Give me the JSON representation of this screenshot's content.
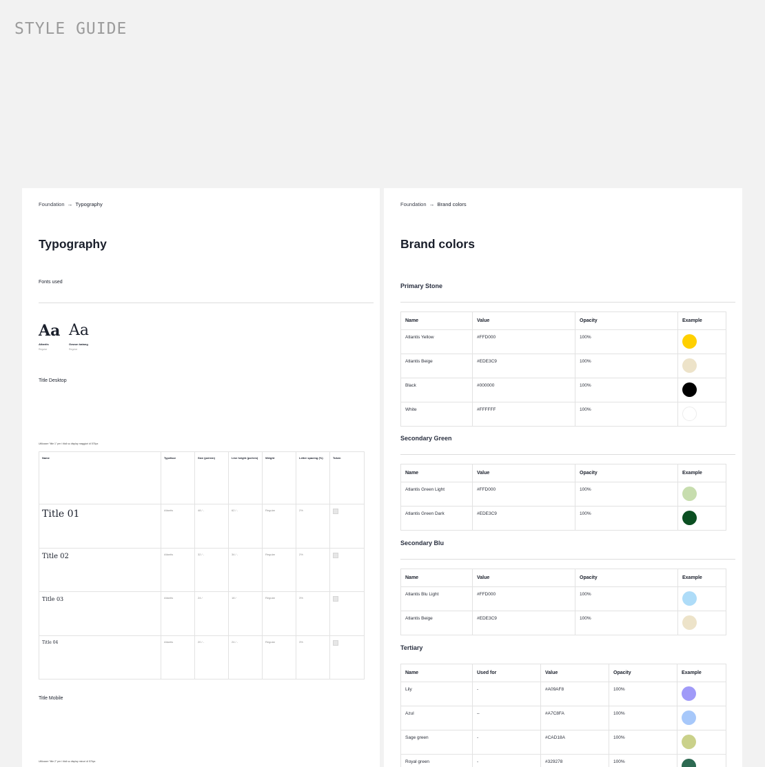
{
  "header": {
    "title": "STYLE GUIDE"
  },
  "typography": {
    "breadcrumb": {
      "parent": "Foundation",
      "current": "Typography"
    },
    "title": "Typography",
    "fonts_used_label": "Fonts used",
    "fonts": [
      {
        "glyph": "Aa",
        "name": "Atlantis",
        "style": "Regular"
      },
      {
        "glyph": "Aa",
        "name": "Gowun batang",
        "style": "Regular"
      }
    ],
    "title_desktop_label": "Title Desktop",
    "desktop_note": "Utilizzare \"title 1\" per i titoli su display maggiori di 576px",
    "table": {
      "headers": [
        "Name",
        "Typeface",
        "Size (px/rem)",
        "Line height (px/rem)",
        "Weight",
        "Letter spacing (%)",
        "Token"
      ],
      "rows": [
        {
          "name": "Title 01",
          "typeface": "Atlantis",
          "size": "48 / -",
          "line_height": "62 / -",
          "weight": "Regular",
          "letter_spacing": "2%"
        },
        {
          "name": "Title 02",
          "typeface": "Atlantis",
          "size": "32 / -",
          "line_height": "34 / -",
          "weight": "Regular",
          "letter_spacing": "2%"
        },
        {
          "name": "Title 03",
          "typeface": "Atlantis",
          "size": "24 /",
          "line_height": "18 /",
          "weight": "Regular",
          "letter_spacing": "3%"
        },
        {
          "name": "Title 04",
          "typeface": "Atlantis",
          "size": "20 / -",
          "line_height": "24 / -",
          "weight": "Regular",
          "letter_spacing": "3%"
        }
      ]
    },
    "title_mobile_label": "Title Mobile",
    "mobile_note": "Utilizzare \"title 2\" per i titoli su display minori di 576px"
  },
  "brand_colors": {
    "breadcrumb": {
      "parent": "Foundation",
      "current": "Brand colors"
    },
    "title": "Brand colors",
    "headers": [
      "Name",
      "Value",
      "Opacity",
      "Example"
    ],
    "tertiary_headers": [
      "Name",
      "Used for",
      "Value",
      "Opacity",
      "Example"
    ],
    "sections": [
      {
        "title": "Primary Stone",
        "rows": [
          {
            "name": "Atlantis Yellow",
            "value": "#FFD000",
            "opacity": "100%",
            "swatch": "#FFD000"
          },
          {
            "name": "Atlantis Beige",
            "value": "#EDE3C9",
            "opacity": "100%",
            "swatch": "#EDE3C9"
          },
          {
            "name": "Black",
            "value": "#000000",
            "opacity": "100%",
            "swatch": "#000000"
          },
          {
            "name": "White",
            "value": "#FFFFFF",
            "opacity": "100%",
            "swatch": "#FFFFFF"
          }
        ]
      },
      {
        "title": "Secondary Green",
        "rows": [
          {
            "name": "Atlantis Green Light",
            "value": "#FFD000",
            "opacity": "100%",
            "swatch": "#C7DDAE"
          },
          {
            "name": "Atlantis Green Dark",
            "value": "#EDE3C9",
            "opacity": "100%",
            "swatch": "#0B4F22"
          }
        ]
      },
      {
        "title": "Secondary Blu",
        "rows": [
          {
            "name": "Atlantis Blu Light",
            "value": "#FFD000",
            "opacity": "100%",
            "swatch": "#AEDCF8"
          },
          {
            "name": "Atlantis Beige",
            "value": "#EDE3C9",
            "opacity": "100%",
            "swatch": "#EDE3C9"
          }
        ]
      },
      {
        "title": "Tertiary",
        "rows": [
          {
            "name": "Lily",
            "used_for": "-",
            "value": "#A09AF8",
            "opacity": "100%",
            "swatch": "#A09AF8"
          },
          {
            "name": "Azul",
            "used_for": "–",
            "value": "#A7C8FA",
            "opacity": "100%",
            "swatch": "#A7C8FA"
          },
          {
            "name": "Sage green",
            "used_for": "-",
            "value": "#CAD18A",
            "opacity": "100%",
            "swatch": "#CAD18A"
          },
          {
            "name": "Royal green",
            "used_for": "-",
            "value": "#329278",
            "opacity": "100%",
            "swatch": "#2D6A52"
          }
        ]
      }
    ]
  }
}
